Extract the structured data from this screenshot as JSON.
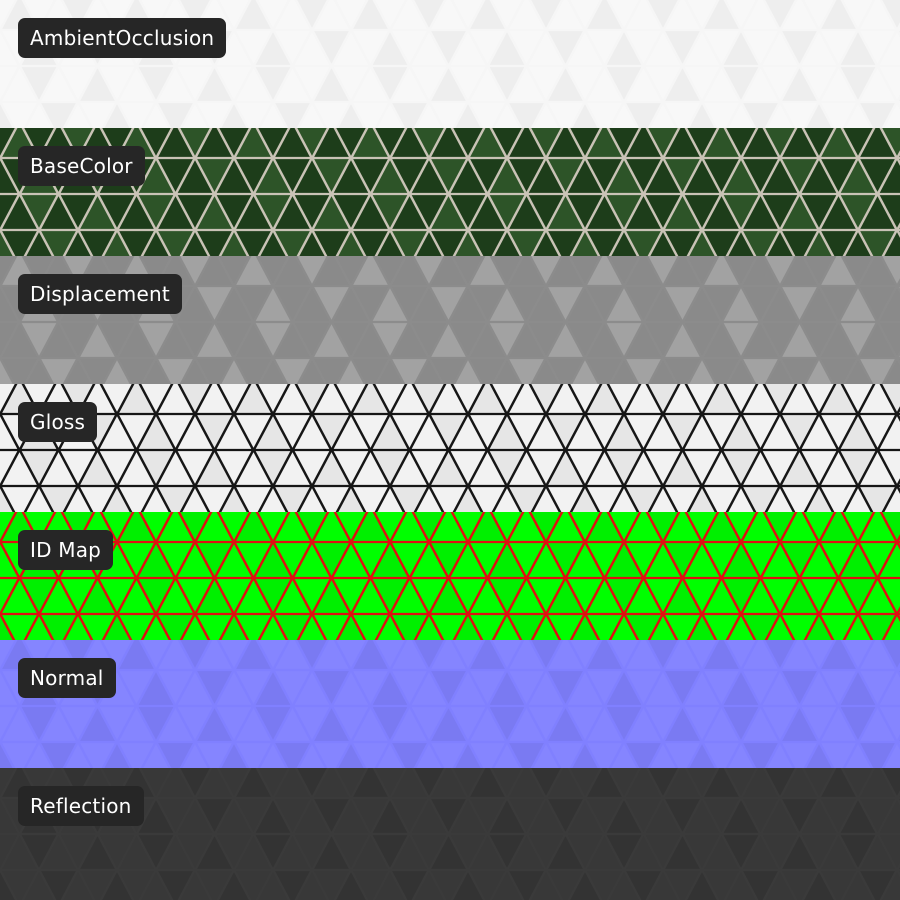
{
  "maps": [
    {
      "id": "ao",
      "label": "AmbientOcclusion",
      "bg": "#f6f6f6",
      "line": "#bdbdbd",
      "fill": "#f8f8f8",
      "fill2": "#eeeeee"
    },
    {
      "id": "base",
      "label": "BaseColor",
      "bg": "#c9c3b6",
      "line": "#d2ccbf",
      "fill": "#1d3d1a",
      "fill2": "#2d5428"
    },
    {
      "id": "disp",
      "label": "Displacement",
      "bg": "#8c8c8c",
      "line": "#9a9a9a",
      "fill": "#8a8a8a",
      "fill2": "#a2a2a2"
    },
    {
      "id": "gloss",
      "label": "Gloss",
      "bg": "#161616",
      "line": "#161616",
      "fill": "#f2f2f2",
      "fill2": "#e6e6e6"
    },
    {
      "id": "id",
      "label": "ID Map",
      "bg": "#e01010",
      "line": "#e01010",
      "fill": "#00ff00",
      "fill2": "#00f000"
    },
    {
      "id": "normal",
      "label": "Normal",
      "bg": "#8080ff",
      "line": "#6a6ae8",
      "fill": "#8585ff",
      "fill2": "#7a7af2"
    },
    {
      "id": "refl",
      "label": "Reflection",
      "bg": "#3a3a3a",
      "line": "#2a2a2a",
      "fill": "#383838",
      "fill2": "#333333"
    }
  ]
}
